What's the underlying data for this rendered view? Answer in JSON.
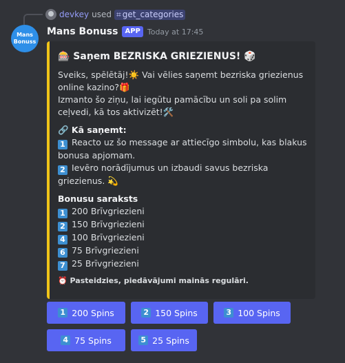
{
  "reply": {
    "user": "devkey",
    "verb": "used",
    "command": "get_categories"
  },
  "message": {
    "avatar_text_line1": "Mans",
    "avatar_text_line2": "Bonuss",
    "author": "Mans Bonuss",
    "app_tag": "APP",
    "timestamp": "Today at 17:45"
  },
  "embed": {
    "accent_color": "#f0c419",
    "title": "🎰 Saņem BEZRISKA GRIEZIENUS! 🎲",
    "intro_line1": "Sveiks, spēlētāj!☀️ Vai vēlies saņemt bezriska griezienus online kazino?🎁",
    "intro_line2": "Izmanto šo ziņu, lai iegūtu pamācību un soli pa solim ceļvedi, kā tos aktivizēt!🛠️",
    "howto_title": "🔗 Kā saņemt:",
    "step1_num": "1",
    "step1_text": "Reacto uz šo message ar attiecīgo simbolu, kas blakus bonusa apjomam.",
    "step2_num": "2",
    "step2_text": "Ievēro norādījumus un izbaudi savus bezriska griezienus. 💫",
    "list_title": "Bonusu saraksts",
    "list": [
      {
        "num": "1",
        "label": "200 Brīvgriezieni"
      },
      {
        "num": "2",
        "label": "150 Brīvgriezieni"
      },
      {
        "num": "4",
        "label": "100 Brīvgriezieni"
      },
      {
        "num": "6",
        "label": "75 Brīvgriezieni"
      },
      {
        "num": "7",
        "label": "25 Brīvgriezieni"
      }
    ],
    "footer": "⏰ Pasteidzies, piedāvājumi mainās regulāri."
  },
  "buttons": [
    {
      "num": "1",
      "label": "200 Spins"
    },
    {
      "num": "2",
      "label": "150 Spins"
    },
    {
      "num": "3",
      "label": "100 Spins"
    },
    {
      "num": "4",
      "label": "75 Spins"
    },
    {
      "num": "5",
      "label": "25 Spins"
    }
  ],
  "colors": {
    "background": "#313338",
    "embed_bg": "#2b2d31",
    "button": "#5865f2",
    "keycap": "#3d8fd1"
  }
}
